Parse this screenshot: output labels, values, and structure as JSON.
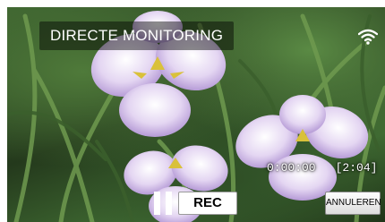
{
  "screen": {
    "title": "DIRECTE MONITORING"
  },
  "status": {
    "wifi_icon": "wifi-icon"
  },
  "recording": {
    "elapsed_time": "0:00:00",
    "remaining_time": "[2:04]"
  },
  "controls": {
    "pause_icon": "pause-icon",
    "rec_label": "REC",
    "cancel_label": "ANNULEREN"
  },
  "colors": {
    "overlay_text": "#ffffff",
    "button_background": "#ffffff",
    "button_text": "#000000"
  }
}
